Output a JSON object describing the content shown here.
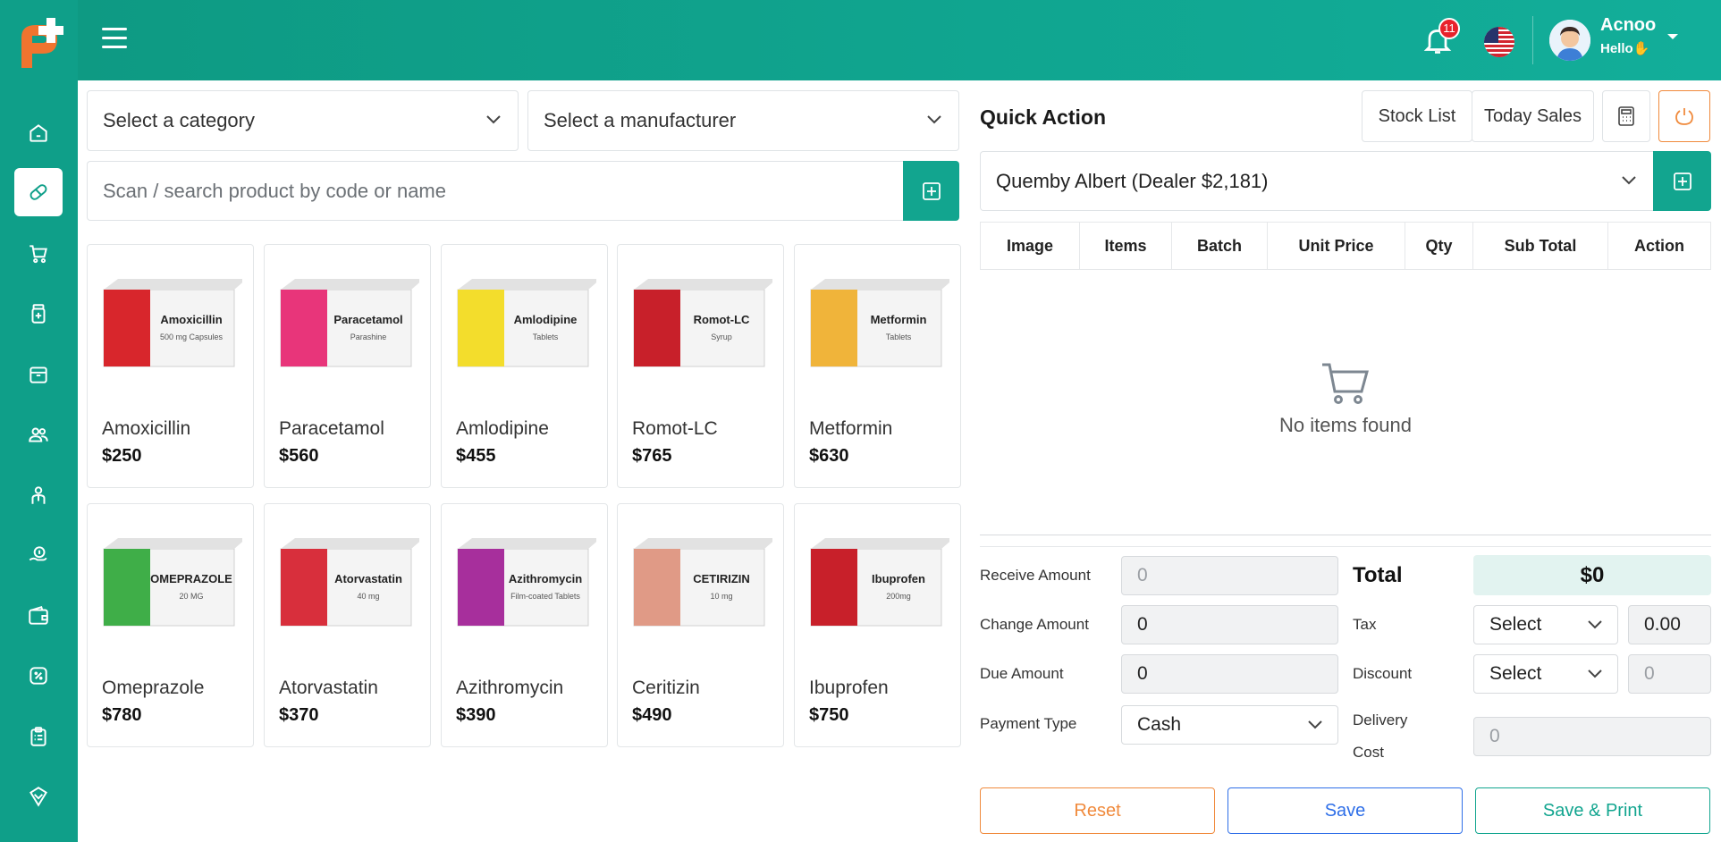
{
  "header": {
    "notification_count": "11",
    "user_name": "Acnoo",
    "user_greeting": "Hello✋"
  },
  "filters": {
    "category_label": "Select a category",
    "manufacturer_label": "Select a manufacturer",
    "search_placeholder": "Scan / search product by code or name"
  },
  "products": [
    {
      "name": "Amoxicillin",
      "price": "$250",
      "pack_text": "Amoxicillin",
      "pack_sub": "500 mg Capsules",
      "pack_color": "#d8262c"
    },
    {
      "name": "Paracetamol",
      "price": "$560",
      "pack_text": "Paracetamol",
      "pack_sub": "Parashine",
      "pack_color": "#e8357a"
    },
    {
      "name": "Amlodipine",
      "price": "$455",
      "pack_text": "Amlodipine",
      "pack_sub": "Tablets",
      "pack_color": "#f3dd2c"
    },
    {
      "name": "Romot-LC",
      "price": "$765",
      "pack_text": "Romot-LC",
      "pack_sub": "Syrup",
      "pack_color": "#c8202a"
    },
    {
      "name": "Metformin",
      "price": "$630",
      "pack_text": "Metformin",
      "pack_sub": "Tablets",
      "pack_color": "#f0b43a"
    },
    {
      "name": "Omeprazole",
      "price": "$780",
      "pack_text": "OMEPRAZOLE",
      "pack_sub": "20 MG",
      "pack_color": "#3fae48"
    },
    {
      "name": "Atorvastatin",
      "price": "$370",
      "pack_text": "Atorvastatin",
      "pack_sub": "40 mg",
      "pack_color": "#d82f3c"
    },
    {
      "name": "Azithromycin",
      "price": "$390",
      "pack_text": "Azithromycin",
      "pack_sub": "Film-coated Tablets",
      "pack_color": "#a72f9c"
    },
    {
      "name": "Ceritizin",
      "price": "$490",
      "pack_text": "CETIRIZIN",
      "pack_sub": "10 mg",
      "pack_color": "#e09a86"
    },
    {
      "name": "Ibuprofen",
      "price": "$750",
      "pack_text": "Ibuprofen",
      "pack_sub": "200mg",
      "pack_color": "#c8202a"
    }
  ],
  "quick_action": {
    "title": "Quick Action",
    "stock_list": "Stock List",
    "today_sales": "Today Sales",
    "customer": "Quemby Albert (Dealer $2,181)"
  },
  "cart": {
    "columns": [
      "Image",
      "Items",
      "Batch",
      "Unit Price",
      "Qty",
      "Sub Total",
      "Action"
    ],
    "empty_text": "No items found"
  },
  "summary": {
    "receive_amount_label": "Receive Amount",
    "receive_amount_placeholder": "0",
    "change_amount_label": "Change Amount",
    "change_amount_value": "0",
    "due_amount_label": "Due Amount",
    "due_amount_value": "0",
    "payment_type_label": "Payment Type",
    "payment_type_value": "Cash",
    "total_label": "Total",
    "total_value": "$0",
    "tax_label": "Tax",
    "tax_select": "Select",
    "tax_value": "0.00",
    "discount_label": "Discount",
    "discount_select": "Select",
    "discount_placeholder": "0",
    "delivery_label_1": "Delivery",
    "delivery_label_2": "Cost",
    "delivery_placeholder": "0"
  },
  "actions": {
    "reset": "Reset",
    "save": "Save",
    "save_print": "Save & Print"
  },
  "colors": {
    "brand": "#0f9f89",
    "accent_orange": "#f08a3c",
    "accent_blue": "#2f6fe8",
    "badge_red": "#e8222b"
  }
}
